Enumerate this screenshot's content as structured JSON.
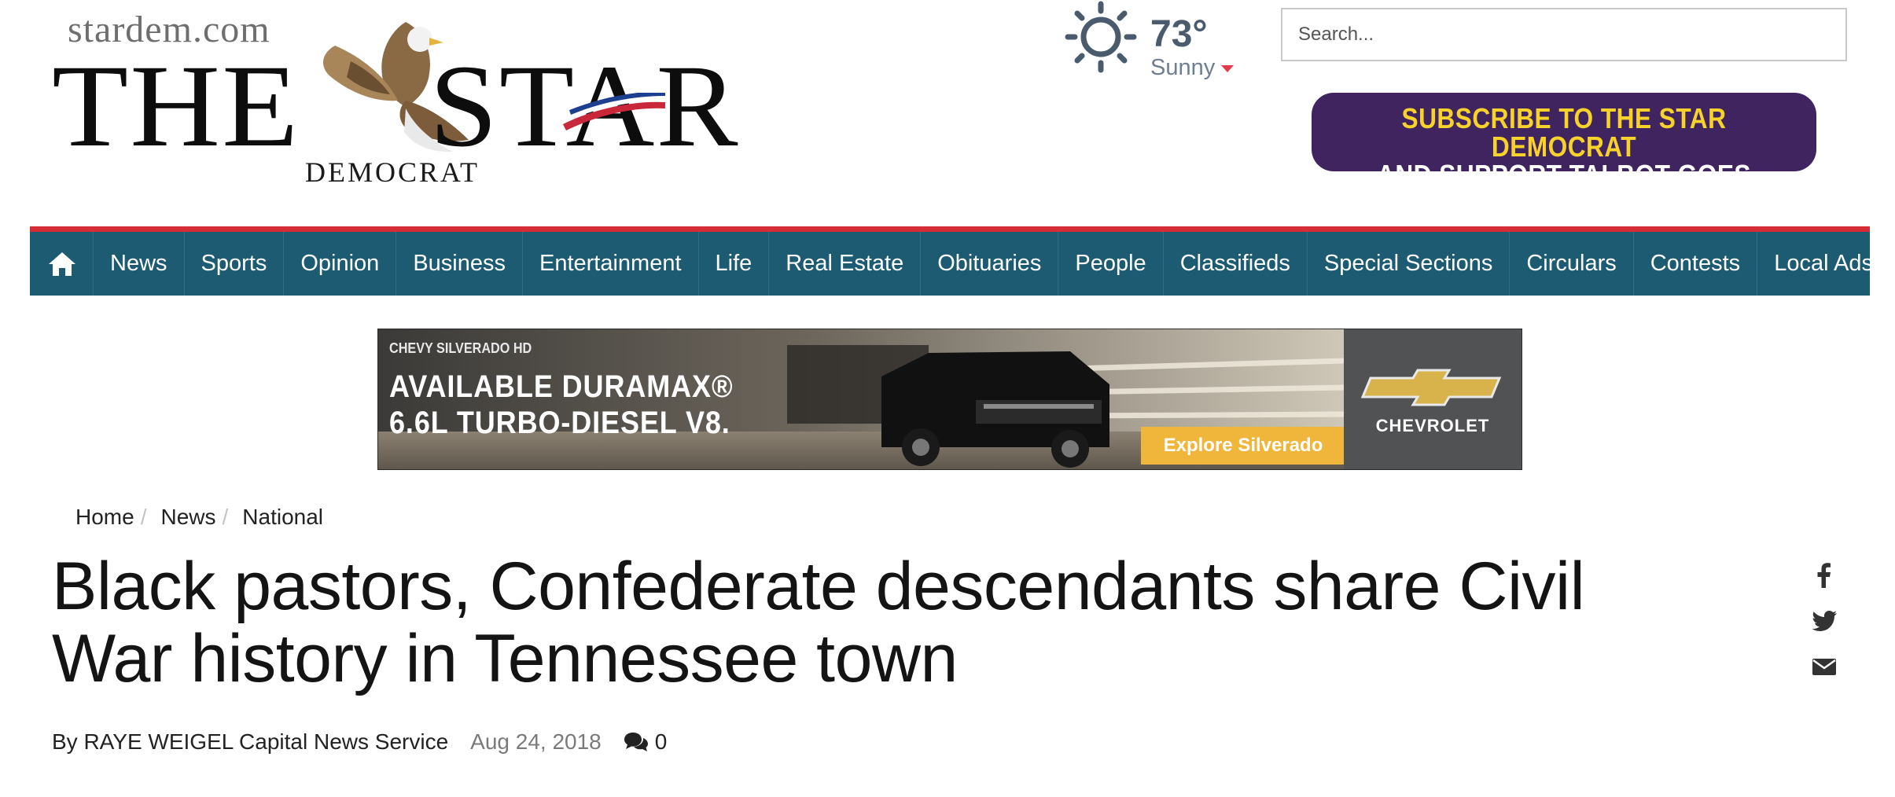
{
  "header": {
    "logo": {
      "site": "stardem.com",
      "word_the": "THE",
      "word_star": "STAR",
      "word_democrat": "DEMOCRAT"
    },
    "weather": {
      "temperature": "73°",
      "condition": "Sunny",
      "icon": "sun-icon"
    },
    "search": {
      "placeholder": "Search...",
      "value": ""
    },
    "subscribe_ad": {
      "line1": "SUBSCRIBE TO THE STAR DEMOCRAT",
      "line2": "AND SUPPORT TALBOT GOES PURPLE"
    }
  },
  "nav": {
    "home_icon": "home-icon",
    "items": [
      "News",
      "Sports",
      "Opinion",
      "Business",
      "Entertainment",
      "Life",
      "Real Estate",
      "Obituaries",
      "People",
      "Classifieds",
      "Special Sections",
      "Circulars",
      "Contests",
      "Local Ads"
    ]
  },
  "banner_ad": {
    "model": "CHEVY SILVERADO HD",
    "headline_line1": "AVAILABLE DURAMAX®",
    "headline_line2": "6.6L TURBO-DIESEL V8.",
    "cta": "Explore Silverado",
    "brand": "CHEVROLET"
  },
  "breadcrumb": [
    "Home",
    "News",
    "National"
  ],
  "article": {
    "headline": "Black pastors, Confederate descendants share Civil War history in Tennessee town",
    "byline": "By RAYE WEIGEL Capital News Service",
    "date": "Aug 24, 2018",
    "comment_count": "0"
  },
  "share": [
    "facebook-icon",
    "twitter-icon",
    "email-icon"
  ],
  "colors": {
    "nav_bg": "#1d5b73",
    "nav_top_border": "#d62c36",
    "subscribe_bg": "#402460",
    "subscribe_accent": "#f6d22b",
    "weather_text": "#4a5b6e",
    "cta_bg": "#f0b63b"
  }
}
